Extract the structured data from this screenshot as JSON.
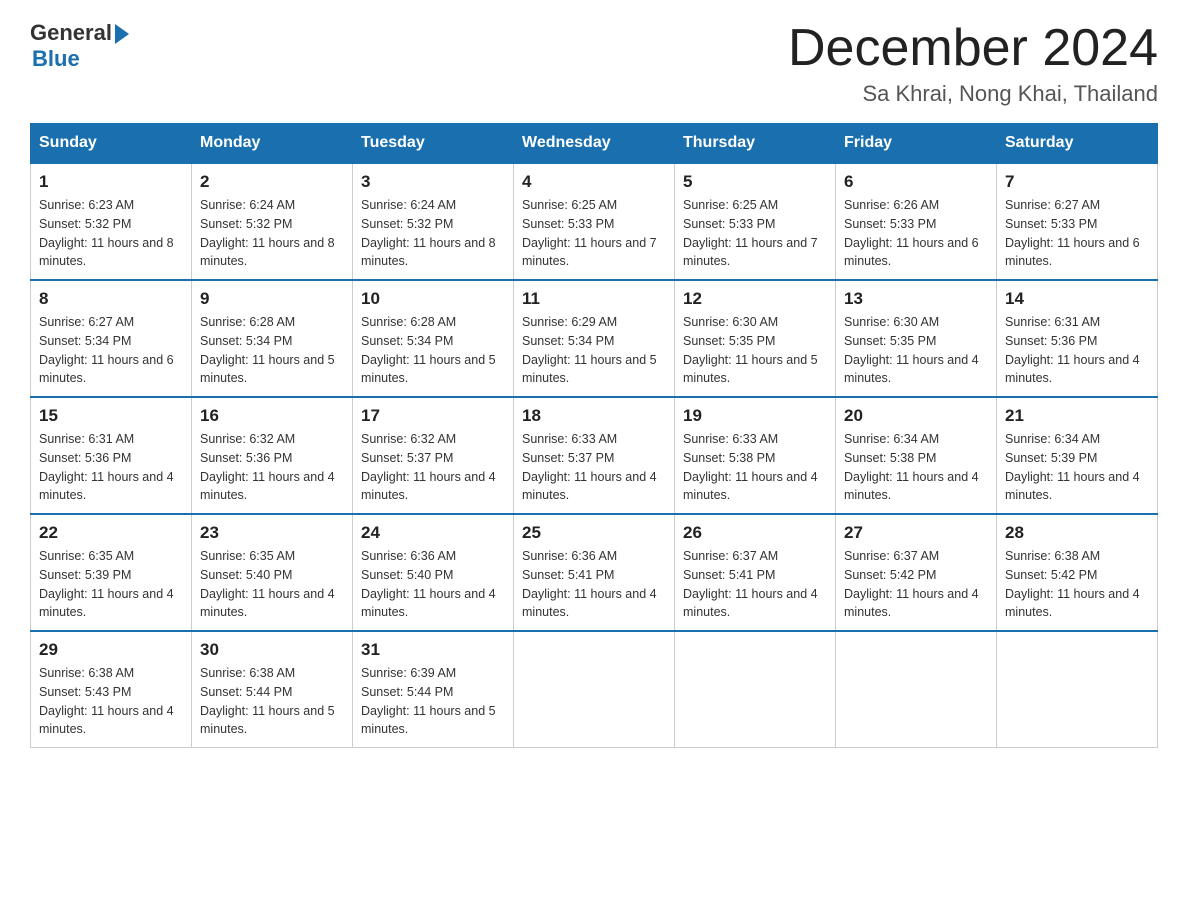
{
  "header": {
    "logo_general": "General",
    "logo_blue": "Blue",
    "month_title": "December 2024",
    "subtitle": "Sa Khrai, Nong Khai, Thailand"
  },
  "weekdays": [
    "Sunday",
    "Monday",
    "Tuesday",
    "Wednesday",
    "Thursday",
    "Friday",
    "Saturday"
  ],
  "weeks": [
    [
      {
        "day": "1",
        "sunrise": "6:23 AM",
        "sunset": "5:32 PM",
        "daylight": "11 hours and 8 minutes."
      },
      {
        "day": "2",
        "sunrise": "6:24 AM",
        "sunset": "5:32 PM",
        "daylight": "11 hours and 8 minutes."
      },
      {
        "day": "3",
        "sunrise": "6:24 AM",
        "sunset": "5:32 PM",
        "daylight": "11 hours and 8 minutes."
      },
      {
        "day": "4",
        "sunrise": "6:25 AM",
        "sunset": "5:33 PM",
        "daylight": "11 hours and 7 minutes."
      },
      {
        "day": "5",
        "sunrise": "6:25 AM",
        "sunset": "5:33 PM",
        "daylight": "11 hours and 7 minutes."
      },
      {
        "day": "6",
        "sunrise": "6:26 AM",
        "sunset": "5:33 PM",
        "daylight": "11 hours and 6 minutes."
      },
      {
        "day": "7",
        "sunrise": "6:27 AM",
        "sunset": "5:33 PM",
        "daylight": "11 hours and 6 minutes."
      }
    ],
    [
      {
        "day": "8",
        "sunrise": "6:27 AM",
        "sunset": "5:34 PM",
        "daylight": "11 hours and 6 minutes."
      },
      {
        "day": "9",
        "sunrise": "6:28 AM",
        "sunset": "5:34 PM",
        "daylight": "11 hours and 5 minutes."
      },
      {
        "day": "10",
        "sunrise": "6:28 AM",
        "sunset": "5:34 PM",
        "daylight": "11 hours and 5 minutes."
      },
      {
        "day": "11",
        "sunrise": "6:29 AM",
        "sunset": "5:34 PM",
        "daylight": "11 hours and 5 minutes."
      },
      {
        "day": "12",
        "sunrise": "6:30 AM",
        "sunset": "5:35 PM",
        "daylight": "11 hours and 5 minutes."
      },
      {
        "day": "13",
        "sunrise": "6:30 AM",
        "sunset": "5:35 PM",
        "daylight": "11 hours and 4 minutes."
      },
      {
        "day": "14",
        "sunrise": "6:31 AM",
        "sunset": "5:36 PM",
        "daylight": "11 hours and 4 minutes."
      }
    ],
    [
      {
        "day": "15",
        "sunrise": "6:31 AM",
        "sunset": "5:36 PM",
        "daylight": "11 hours and 4 minutes."
      },
      {
        "day": "16",
        "sunrise": "6:32 AM",
        "sunset": "5:36 PM",
        "daylight": "11 hours and 4 minutes."
      },
      {
        "day": "17",
        "sunrise": "6:32 AM",
        "sunset": "5:37 PM",
        "daylight": "11 hours and 4 minutes."
      },
      {
        "day": "18",
        "sunrise": "6:33 AM",
        "sunset": "5:37 PM",
        "daylight": "11 hours and 4 minutes."
      },
      {
        "day": "19",
        "sunrise": "6:33 AM",
        "sunset": "5:38 PM",
        "daylight": "11 hours and 4 minutes."
      },
      {
        "day": "20",
        "sunrise": "6:34 AM",
        "sunset": "5:38 PM",
        "daylight": "11 hours and 4 minutes."
      },
      {
        "day": "21",
        "sunrise": "6:34 AM",
        "sunset": "5:39 PM",
        "daylight": "11 hours and 4 minutes."
      }
    ],
    [
      {
        "day": "22",
        "sunrise": "6:35 AM",
        "sunset": "5:39 PM",
        "daylight": "11 hours and 4 minutes."
      },
      {
        "day": "23",
        "sunrise": "6:35 AM",
        "sunset": "5:40 PM",
        "daylight": "11 hours and 4 minutes."
      },
      {
        "day": "24",
        "sunrise": "6:36 AM",
        "sunset": "5:40 PM",
        "daylight": "11 hours and 4 minutes."
      },
      {
        "day": "25",
        "sunrise": "6:36 AM",
        "sunset": "5:41 PM",
        "daylight": "11 hours and 4 minutes."
      },
      {
        "day": "26",
        "sunrise": "6:37 AM",
        "sunset": "5:41 PM",
        "daylight": "11 hours and 4 minutes."
      },
      {
        "day": "27",
        "sunrise": "6:37 AM",
        "sunset": "5:42 PM",
        "daylight": "11 hours and 4 minutes."
      },
      {
        "day": "28",
        "sunrise": "6:38 AM",
        "sunset": "5:42 PM",
        "daylight": "11 hours and 4 minutes."
      }
    ],
    [
      {
        "day": "29",
        "sunrise": "6:38 AM",
        "sunset": "5:43 PM",
        "daylight": "11 hours and 4 minutes."
      },
      {
        "day": "30",
        "sunrise": "6:38 AM",
        "sunset": "5:44 PM",
        "daylight": "11 hours and 5 minutes."
      },
      {
        "day": "31",
        "sunrise": "6:39 AM",
        "sunset": "5:44 PM",
        "daylight": "11 hours and 5 minutes."
      },
      null,
      null,
      null,
      null
    ]
  ]
}
